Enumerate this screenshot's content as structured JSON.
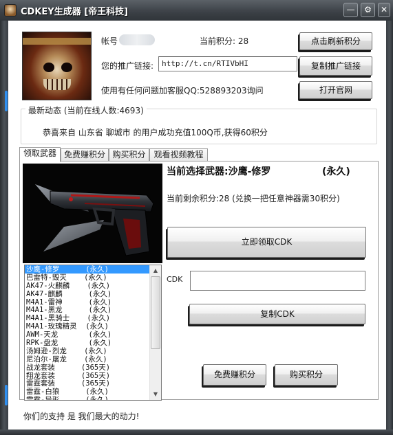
{
  "window": {
    "title": "CDKEY生成器 [帝王科技]",
    "minimize": "—",
    "settings": "⚙",
    "close": "✕"
  },
  "account": {
    "username_label": "帐号",
    "points_label": "当前积分: 28",
    "referral_label": "您的推广链接:",
    "referral_link": "http://t.cn/RTIVbHI",
    "support_text": "使用有任何问题加客服QQ:528893203询问"
  },
  "header_buttons": {
    "refresh": "点击刷新积分",
    "copy_link": "复制推广链接",
    "open_site": "打开官网"
  },
  "news": {
    "title": "最新动态 (当前在线人数:4693)",
    "message": "恭喜来自 山东省 聊城市 的用户成功充值100Q币,获得60积分"
  },
  "tabs": [
    {
      "label": "领取武器"
    },
    {
      "label": "免费赚积分"
    },
    {
      "label": "购买积分"
    },
    {
      "label": "观看视频教程"
    }
  ],
  "weapon": {
    "title": "当前选择武器:沙鹰-修罗",
    "duration": "(永久)",
    "remaining": "当前剩余积分:28 (兑换一把任意神器需30积分)",
    "claim_button": "立即领取CDK",
    "cdk_label": "CDK",
    "cdk_value": "",
    "copy_button": "复制CDK"
  },
  "weapon_list": [
    "沙鹰-修罗      (永久)",
    "巴雷特-毁灭    (永久)",
    "AK47-火麒麟    (永久)",
    "AK47-麒麟      (永久)",
    "M4A1-雷神      (永久)",
    "M4A1-黑龙      (永久)",
    "M4A1-黑骑士    (永久)",
    "M4A1-玫瑰精灵  (永久)",
    "AWM-天龙       (永久)",
    "RPK-盘龙       (永久)",
    "汤姆逊-烈龙    (永久)",
    "尼泊尔-屠龙    (永久)",
    "战龙套装      (365天)",
    "翔龙套装      (365天)",
    "雷霆套装      (365天)",
    "雷霆-白狼      (永久)",
    "雷霆-异形      (永久)"
  ],
  "bottom_buttons": {
    "earn": "免费赚积分",
    "buy": "购买积分"
  },
  "footer": "你们的支持 是 我们最大的动力!",
  "colors": {
    "selection": "#3399ff",
    "titlebar": "#3b4046",
    "accent_glow": "#2f8ff0"
  }
}
